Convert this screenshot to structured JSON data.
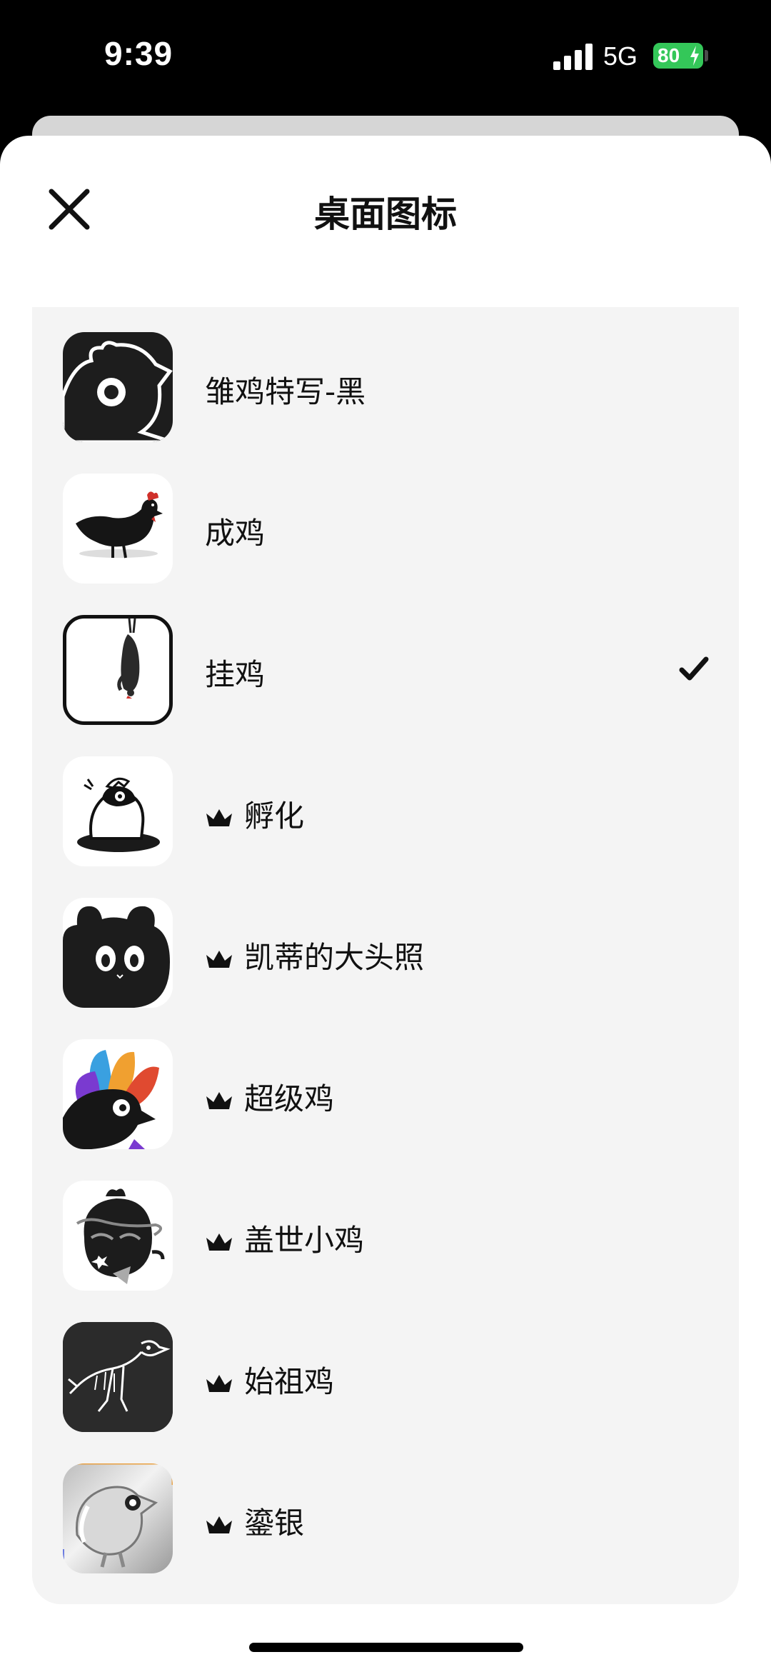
{
  "status_bar": {
    "time": "9:39",
    "network": "5G",
    "battery": "80"
  },
  "sheet": {
    "title": "桌面图标"
  },
  "icons": [
    {
      "label": "雏鸡特写-黑",
      "premium": false,
      "selected": false
    },
    {
      "label": "成鸡",
      "premium": false,
      "selected": false
    },
    {
      "label": "挂鸡",
      "premium": false,
      "selected": true
    },
    {
      "label": "孵化",
      "premium": true,
      "selected": false
    },
    {
      "label": "凯蒂的大头照",
      "premium": true,
      "selected": false
    },
    {
      "label": "超级鸡",
      "premium": true,
      "selected": false
    },
    {
      "label": "盖世小鸡",
      "premium": true,
      "selected": false
    },
    {
      "label": "始祖鸡",
      "premium": true,
      "selected": false
    },
    {
      "label": "鎏银",
      "premium": true,
      "selected": false
    }
  ]
}
